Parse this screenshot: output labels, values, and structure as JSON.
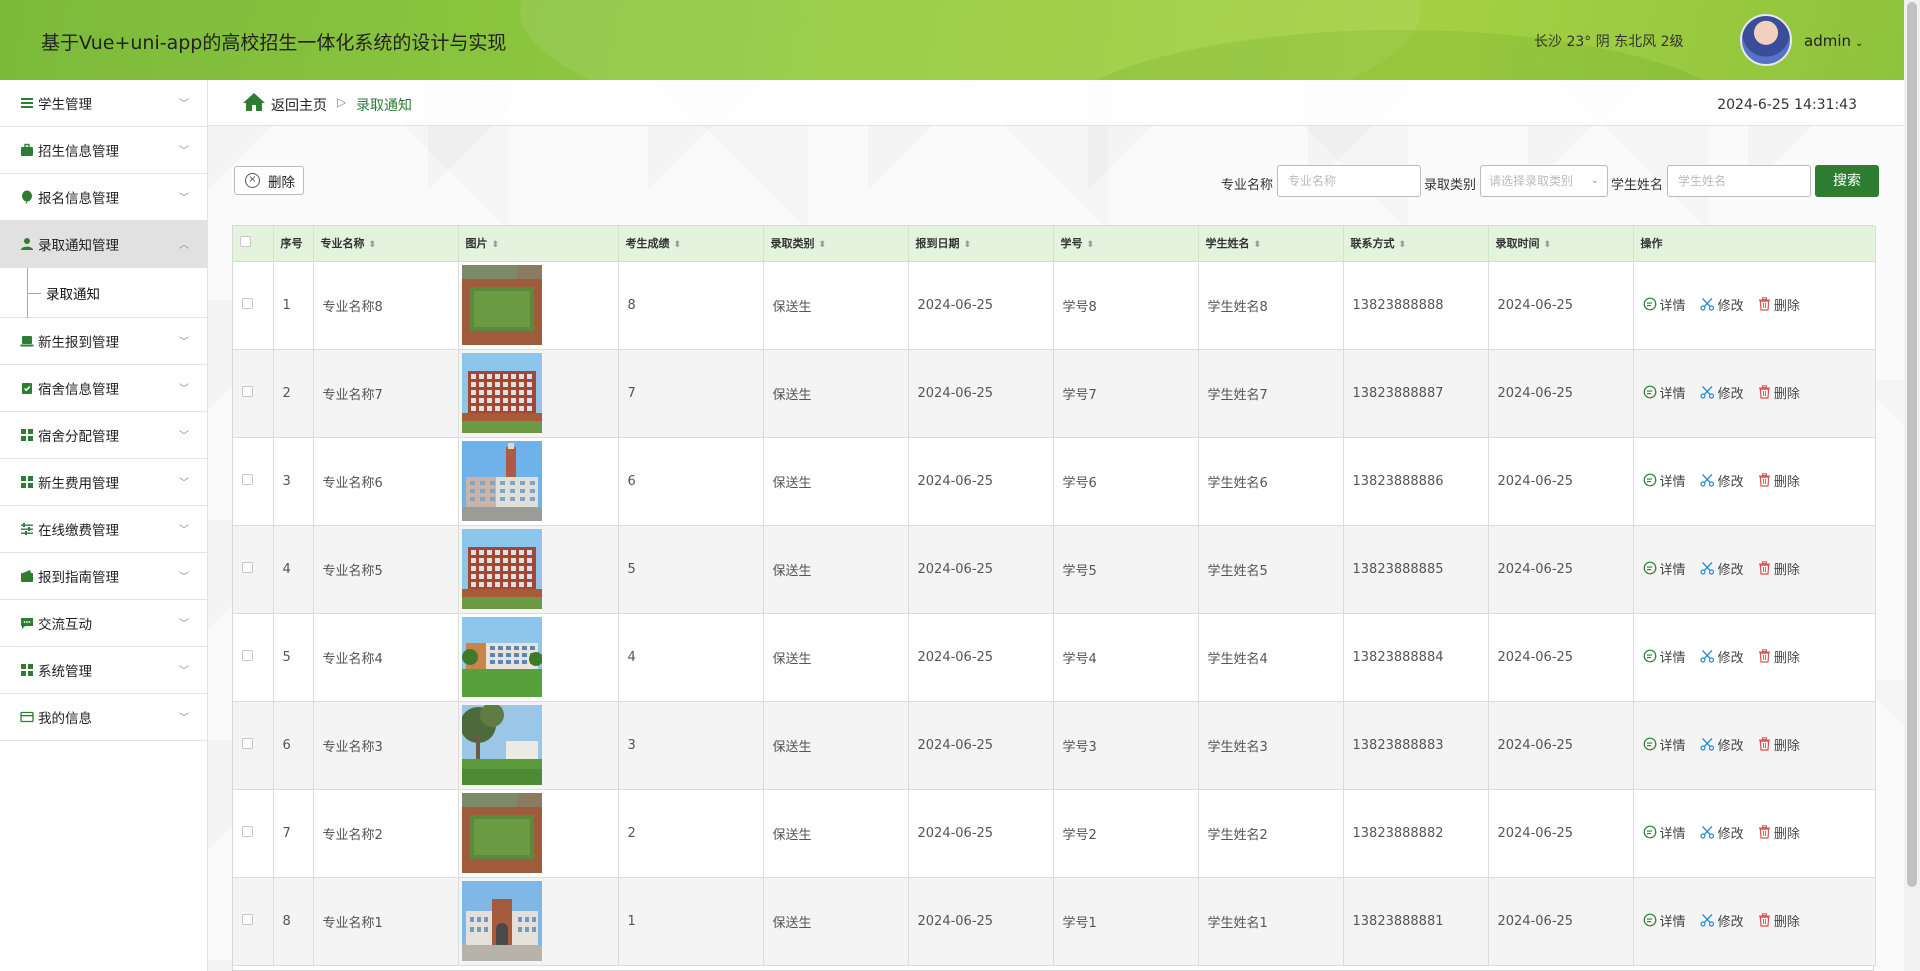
{
  "header": {
    "title": "基于Vue+uni-app的高校招生一体化系统的设计与实现",
    "weather": "长沙  23°  阴  东北风  2级",
    "user": "admin"
  },
  "sidebar": {
    "items": [
      {
        "label": "学生管理",
        "icon": "list-icon"
      },
      {
        "label": "招生信息管理",
        "icon": "briefcase-icon"
      },
      {
        "label": "报名信息管理",
        "icon": "balloon-icon"
      },
      {
        "label": "录取通知管理",
        "icon": "user-icon"
      },
      {
        "label": "新生报到管理",
        "icon": "laptop-icon"
      },
      {
        "label": "宿舍信息管理",
        "icon": "clipboard-check-icon"
      },
      {
        "label": "宿舍分配管理",
        "icon": "grid-icon"
      },
      {
        "label": "新生费用管理",
        "icon": "grid-icon"
      },
      {
        "label": "在线缴费管理",
        "icon": "sliders-icon"
      },
      {
        "label": "报到指南管理",
        "icon": "wallet-icon"
      },
      {
        "label": "交流互动",
        "icon": "chat-icon"
      },
      {
        "label": "系统管理",
        "icon": "grid-icon"
      },
      {
        "label": "我的信息",
        "icon": "card-icon"
      }
    ],
    "active_sub": "录取通知"
  },
  "breadcrumb": {
    "home": "返回主页",
    "separator": "▷",
    "current": "录取通知"
  },
  "datetime": "2024-6-25 14:31:43",
  "toolbar": {
    "delete_label": "删除",
    "major_label": "专业名称",
    "major_placeholder": "专业名称",
    "category_label": "录取类别",
    "category_placeholder": "请选择录取类别",
    "student_label": "学生姓名",
    "student_placeholder": "学生姓名",
    "search_label": "搜索"
  },
  "table": {
    "columns": [
      "序号",
      "专业名称",
      "图片",
      "考生成绩",
      "录取类别",
      "报到日期",
      "学号",
      "学生姓名",
      "联系方式",
      "录取时间",
      "操作"
    ],
    "ops": {
      "detail": "详情",
      "edit": "修改",
      "delete": "删除"
    },
    "rows": [
      {
        "no": "1",
        "major": "专业名称8",
        "score": "8",
        "category": "保送生",
        "report_date": "2024-06-25",
        "sid": "学号8",
        "name": "学生姓名8",
        "phone": "13823888888",
        "admit_time": "2024-06-25",
        "img": "track"
      },
      {
        "no": "2",
        "major": "专业名称7",
        "score": "7",
        "category": "保送生",
        "report_date": "2024-06-25",
        "sid": "学号7",
        "name": "学生姓名7",
        "phone": "13823888887",
        "admit_time": "2024-06-25",
        "img": "brick"
      },
      {
        "no": "3",
        "major": "专业名称6",
        "score": "6",
        "category": "保送生",
        "report_date": "2024-06-25",
        "sid": "学号6",
        "name": "学生姓名6",
        "phone": "13823888886",
        "admit_time": "2024-06-25",
        "img": "tower"
      },
      {
        "no": "4",
        "major": "专业名称5",
        "score": "5",
        "category": "保送生",
        "report_date": "2024-06-25",
        "sid": "学号5",
        "name": "学生姓名5",
        "phone": "13823888885",
        "admit_time": "2024-06-25",
        "img": "brick"
      },
      {
        "no": "5",
        "major": "专业名称4",
        "score": "4",
        "category": "保送生",
        "report_date": "2024-06-25",
        "sid": "学号4",
        "name": "学生姓名4",
        "phone": "13823888884",
        "admit_time": "2024-06-25",
        "img": "lawn"
      },
      {
        "no": "6",
        "major": "专业名称3",
        "score": "3",
        "category": "保送生",
        "report_date": "2024-06-25",
        "sid": "学号3",
        "name": "学生姓名3",
        "phone": "13823888883",
        "admit_time": "2024-06-25",
        "img": "trees"
      },
      {
        "no": "7",
        "major": "专业名称2",
        "score": "2",
        "category": "保送生",
        "report_date": "2024-06-25",
        "sid": "学号2",
        "name": "学生姓名2",
        "phone": "13823888882",
        "admit_time": "2024-06-25",
        "img": "track"
      },
      {
        "no": "8",
        "major": "专业名称1",
        "score": "1",
        "category": "保送生",
        "report_date": "2024-06-25",
        "sid": "学号1",
        "name": "学生姓名1",
        "phone": "13823888881",
        "admit_time": "2024-06-25",
        "img": "gate"
      }
    ]
  },
  "colors": {
    "brand": "#2e7d32",
    "header_start": "#7cba3a",
    "table_header": "#e3f3de"
  }
}
